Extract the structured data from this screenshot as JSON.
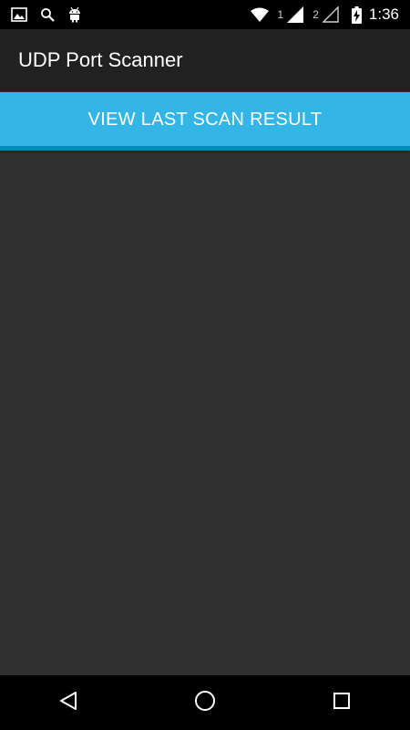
{
  "status_bar": {
    "left_icons": [
      "image-icon",
      "search-icon",
      "android-icon"
    ],
    "sim1_label": "1",
    "sim2_label": "2",
    "time": "1:36"
  },
  "action_bar": {
    "title": "UDP Port Scanner"
  },
  "main": {
    "scan_button_label": "VIEW LAST SCAN RESULT"
  },
  "nav_bar": {
    "buttons": [
      "back-icon",
      "home-icon",
      "recents-icon"
    ]
  },
  "colors": {
    "accent": "#33b5e5",
    "accent_dark": "#0f88b8",
    "background": "#313131",
    "action_bar": "#212121",
    "system_bars": "#000000"
  }
}
